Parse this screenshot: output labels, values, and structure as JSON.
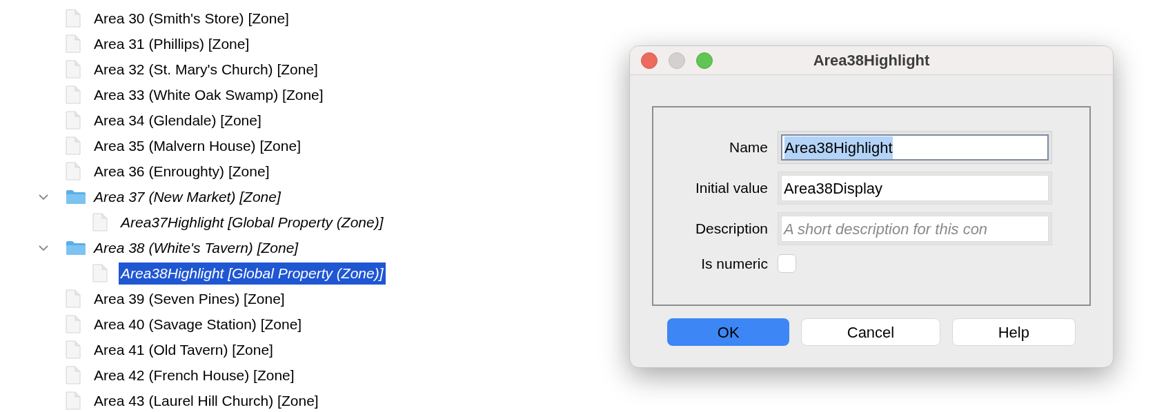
{
  "tree": {
    "items": [
      {
        "label": "Area 30 (Smith's Store) [Zone]",
        "kind": "file",
        "selected": false
      },
      {
        "label": "Area 31 (Phillips) [Zone]",
        "kind": "file",
        "selected": false
      },
      {
        "label": "Area 32 (St. Mary's Church) [Zone]",
        "kind": "file",
        "selected": false
      },
      {
        "label": "Area 33 (White Oak Swamp) [Zone]",
        "kind": "file",
        "selected": false
      },
      {
        "label": "Area 34 (Glendale) [Zone]",
        "kind": "file",
        "selected": false
      },
      {
        "label": "Area 35 (Malvern House) [Zone]",
        "kind": "file",
        "selected": false
      },
      {
        "label": "Area 36 (Enroughty) [Zone]",
        "kind": "file",
        "selected": false
      },
      {
        "label": "Area 37 (New Market) [Zone]",
        "kind": "folder",
        "expanded": true,
        "selected": false,
        "children": [
          {
            "label": "Area37Highlight [Global Property (Zone)]",
            "kind": "property",
            "selected": false
          }
        ]
      },
      {
        "label": "Area 38 (White's Tavern) [Zone]",
        "kind": "folder",
        "expanded": true,
        "selected": false,
        "children": [
          {
            "label": "Area38Highlight [Global Property (Zone)]",
            "kind": "property",
            "selected": true
          }
        ]
      },
      {
        "label": "Area 39 (Seven Pines) [Zone]",
        "kind": "file",
        "selected": false
      },
      {
        "label": "Area 40 (Savage Station) [Zone]",
        "kind": "file",
        "selected": false
      },
      {
        "label": "Area 41 (Old Tavern) [Zone]",
        "kind": "file",
        "selected": false
      },
      {
        "label": "Area 42 (French House) [Zone]",
        "kind": "file",
        "selected": false
      },
      {
        "label": "Area 43 (Laurel Hill Church) [Zone]",
        "kind": "file",
        "selected": false
      }
    ]
  },
  "dialog": {
    "title": "Area38Highlight",
    "fields": [
      {
        "label": "Name",
        "value": "Area38Highlight",
        "focused": true,
        "text_selected": true
      },
      {
        "label": "Initial value",
        "value": "Area38Display",
        "focused": false,
        "text_selected": false
      },
      {
        "label": "Description",
        "placeholder": "A short description for this con",
        "focused": false
      }
    ],
    "checkbox": {
      "label": "Is numeric",
      "checked": false
    },
    "buttons": [
      {
        "label": "OK",
        "default": true
      },
      {
        "label": "Cancel",
        "default": false
      },
      {
        "label": "Help",
        "default": false
      }
    ]
  }
}
